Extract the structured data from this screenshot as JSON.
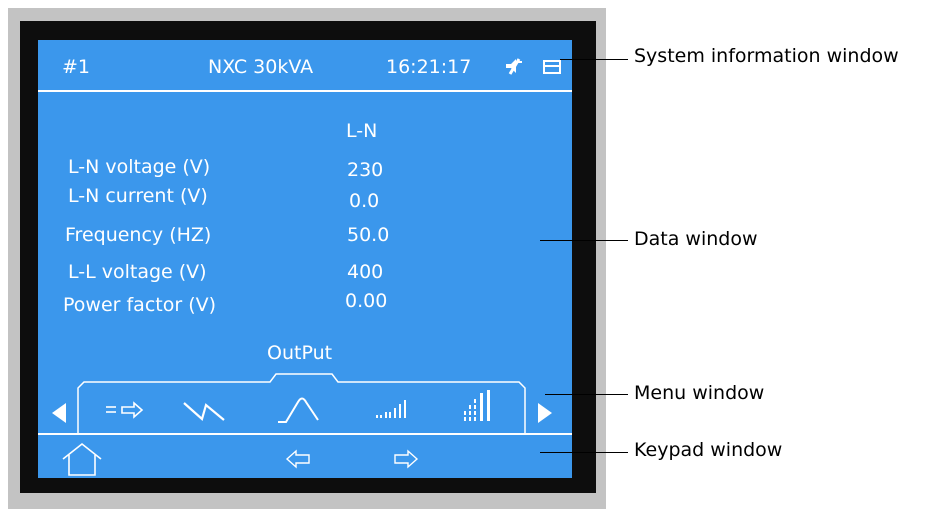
{
  "system_bar": {
    "unit_number": "#1",
    "model": "NXC  30kVA",
    "time": "16:21:17",
    "mute_icon": "mute-speaker-icon",
    "message_icon": "envelope-icon"
  },
  "data_window": {
    "column_header": "L-N",
    "rows": [
      {
        "label": "L-N voltage (V)",
        "value": "230"
      },
      {
        "label": "L-N current (V)",
        "value": "0.0"
      },
      {
        "label": "Frequency (HZ)",
        "value": "50.0"
      },
      {
        "label": "L-L voltage (V)",
        "value": "400"
      },
      {
        "label": "Power factor (V)",
        "value": "0.00"
      }
    ]
  },
  "menu": {
    "selected_title": "OutPut",
    "items": [
      {
        "icon": "dc-arrow-icon"
      },
      {
        "icon": "bypass-icon"
      },
      {
        "icon": "output-sine-icon",
        "selected": true
      },
      {
        "icon": "bars-icon"
      },
      {
        "icon": "bar-grid-icon"
      }
    ]
  },
  "keypad": {
    "icons": [
      "home-icon",
      "left-arrow-icon",
      "right-arrow-icon"
    ]
  },
  "callouts": {
    "system_info": "System information window",
    "data": "Data window",
    "menu": "Menu window",
    "keypad": "Keypad window"
  },
  "colors": {
    "screen": "#3b97ec",
    "frame": "#0d0d0d",
    "bezel": "#c3c3c3",
    "foreground": "#ffffff"
  }
}
